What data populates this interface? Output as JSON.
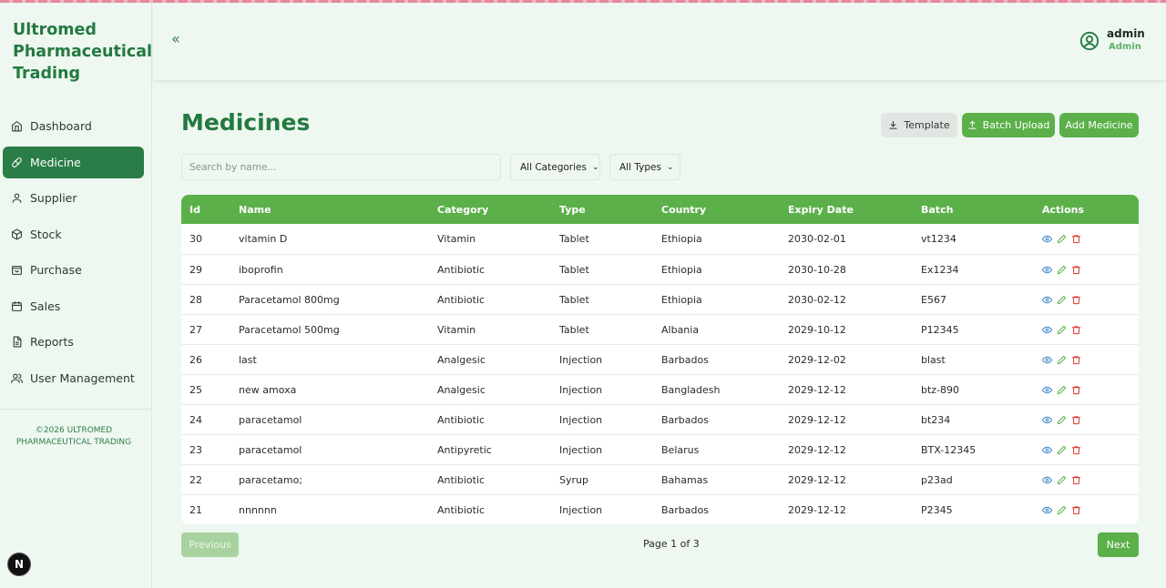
{
  "app": {
    "brand": "Ultromed Pharmaceutical Trading",
    "copyright": "©2026 ULTROMED PHARMACEUTICAL TRADING"
  },
  "sidebar": {
    "items": [
      {
        "label": "Dashboard",
        "icon": "home-icon",
        "active": false
      },
      {
        "label": "Medicine",
        "icon": "pill-icon",
        "active": true
      },
      {
        "label": "Supplier",
        "icon": "user-icon",
        "active": false
      },
      {
        "label": "Stock",
        "icon": "box-icon",
        "active": false
      },
      {
        "label": "Purchase",
        "icon": "bag-icon",
        "active": false
      },
      {
        "label": "Sales",
        "icon": "calendar-icon",
        "active": false
      },
      {
        "label": "Reports",
        "icon": "file-icon",
        "active": false
      },
      {
        "label": "User Management",
        "icon": "users-icon",
        "active": false
      }
    ]
  },
  "header": {
    "collapse_label": "«",
    "user_name": "admin",
    "user_role": "Admin"
  },
  "page": {
    "title": "Medicines"
  },
  "toolbar": {
    "template_label": "Template",
    "batch_upload_label": "Batch Upload",
    "add_label": "Add Medicine"
  },
  "filters": {
    "search_placeholder": "Search by name...",
    "category_value": "All Categories",
    "type_value": "All Types"
  },
  "table": {
    "columns": [
      "Id",
      "Name",
      "Category",
      "Type",
      "Country",
      "Expiry Date",
      "Batch",
      "Actions"
    ],
    "rows": [
      [
        "30",
        "vitamin D",
        "Vitamin",
        "Tablet",
        "Ethiopia",
        "2030-02-01",
        "vt1234"
      ],
      [
        "29",
        "iboprofin",
        "Antibiotic",
        "Tablet",
        "Ethiopia",
        "2030-10-28",
        "Ex1234"
      ],
      [
        "28",
        "Paracetamol 800mg",
        "Antibiotic",
        "Tablet",
        "Ethiopia",
        "2030-02-12",
        "E567"
      ],
      [
        "27",
        "Paracetamol 500mg",
        "Vitamin",
        "Tablet",
        "Albania",
        "2029-10-12",
        "P12345"
      ],
      [
        "26",
        "last",
        "Analgesic",
        "Injection",
        "Barbados",
        "2029-12-02",
        "blast"
      ],
      [
        "25",
        "new amoxa",
        "Analgesic",
        "Injection",
        "Bangladesh",
        "2029-12-12",
        "btz-890"
      ],
      [
        "24",
        "paracetamol",
        "Antibiotic",
        "Injection",
        "Barbados",
        "2029-12-12",
        "bt234"
      ],
      [
        "23",
        "paracetamol",
        "Antipyretic",
        "Injection",
        "Belarus",
        "2029-12-12",
        "BTX-12345"
      ],
      [
        "22",
        "paracetamo;",
        "Antibiotic",
        "Syrup",
        "Bahamas",
        "2029-12-12",
        "p23ad"
      ],
      [
        "21",
        "nnnnnn",
        "Antibiotic",
        "Injection",
        "Barbados",
        "2029-12-12",
        "P2345"
      ]
    ]
  },
  "pagination": {
    "prev_label": "Previous",
    "info": "Page 1 of 3",
    "next_label": "Next"
  },
  "colors": {
    "primary": "#5cb04a",
    "brand": "#237a40",
    "active_nav": "#2a7d46",
    "background": "#eef7f0",
    "view_icon": "#3a86c8",
    "edit_icon": "#5cb04a",
    "delete_icon": "#e0352b"
  }
}
